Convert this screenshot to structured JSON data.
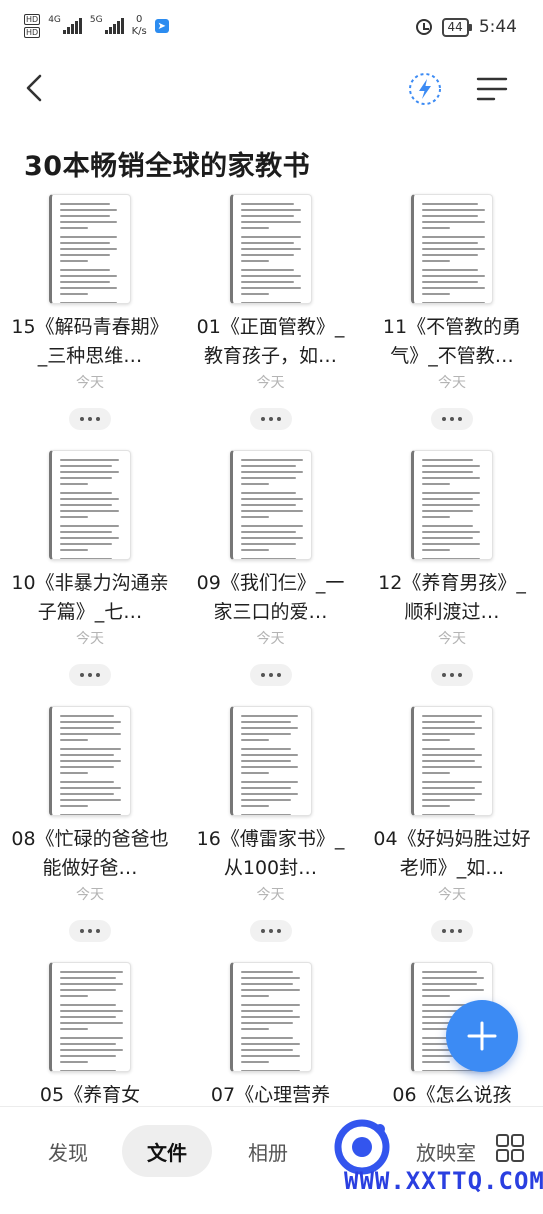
{
  "status_bar": {
    "network_left": "4G",
    "network_right": "5G",
    "speed_value": "0",
    "speed_unit": "K/s",
    "battery": "44",
    "time": "5:44"
  },
  "page": {
    "title": "30本畅销全球的家教书"
  },
  "files": [
    {
      "name": "15《解码青春期》_三种思维…",
      "date": "今天"
    },
    {
      "name": "01《正面管教》_教育孩子，如…",
      "date": "今天"
    },
    {
      "name": "11《不管教的勇气》_不管教…",
      "date": "今天"
    },
    {
      "name": "10《非暴力沟通亲子篇》_七…",
      "date": "今天"
    },
    {
      "name": "09《我们仨》_一家三口的爱…",
      "date": "今天"
    },
    {
      "name": "12《养育男孩》_顺利渡过…",
      "date": "今天"
    },
    {
      "name": "08《忙碌的爸爸也能做好爸…",
      "date": "今天"
    },
    {
      "name": "16《傅雷家书》_从100封…",
      "date": "今天"
    },
    {
      "name": "04《好妈妈胜过好老师》_如…",
      "date": "今天"
    },
    {
      "name": "05《养育女",
      "date": ""
    },
    {
      "name": "07《心理营养",
      "date": ""
    },
    {
      "name": "06《怎么说孩",
      "date": ""
    }
  ],
  "bottom_nav": {
    "discover": "发现",
    "files": "文件",
    "albums": "相册",
    "projection": "放映室"
  },
  "watermark": "WWW.XXTTQ.COM",
  "colors": {
    "accent": "#3c8bf4",
    "watermark": "#2a3fe0"
  }
}
